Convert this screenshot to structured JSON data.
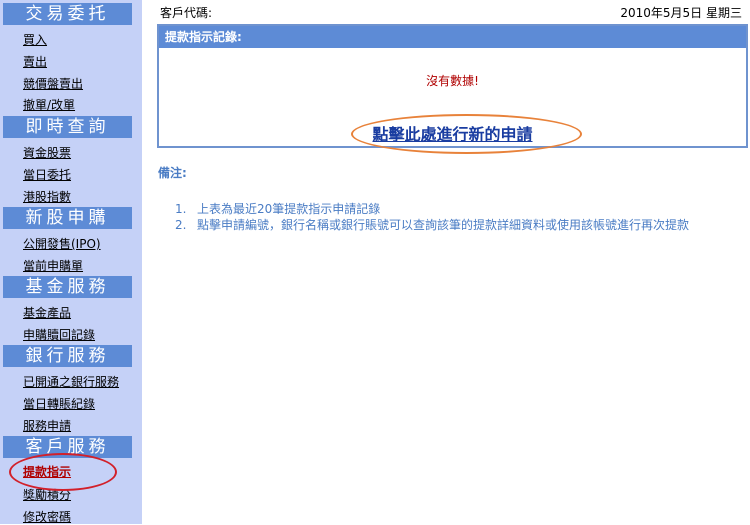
{
  "sidebar": {
    "sections": [
      {
        "title": "交易委托",
        "items": [
          "買入",
          "賣出",
          "競價盤賣出",
          "撤單/改單"
        ]
      },
      {
        "title": "即時查詢",
        "items": [
          "資金股票",
          "當日委托",
          "港股指數"
        ]
      },
      {
        "title": "新股申購",
        "items": [
          "公開發售(IPO)",
          "當前申購單"
        ]
      },
      {
        "title": "基金服務",
        "items": [
          "基金產品",
          "申購贖回記錄"
        ]
      },
      {
        "title": "銀行服務",
        "items": [
          "已開通之銀行服務",
          "當日轉賬紀錄",
          "服務申請"
        ]
      },
      {
        "title": "客戶服務",
        "items": [
          "提款指示",
          "獎勵積分",
          "修改密碼"
        ]
      }
    ]
  },
  "header": {
    "client_code_label": "客戶代碼:",
    "date": "2010年5月5日 星期三"
  },
  "panel": {
    "title": "提款指示記錄:",
    "no_data": "沒有數據!",
    "apply_link": "點擊此處進行新的申請"
  },
  "notes": {
    "title": "備注:",
    "items": [
      {
        "num": "1.",
        "text": "上表為最近20筆提款指示申請記錄"
      },
      {
        "num": "2.",
        "text": "點擊申請編號，銀行名稱或銀行賬號可以查詢該筆的提款詳細資料或使用該帳號進行再次提款"
      }
    ]
  },
  "colors": {
    "sidebar_bg": "#c5d1f7",
    "section_header_bg": "#5d8bd6",
    "accent_blue": "#4a7cc4",
    "error_red": "#b00000",
    "highlight_red_circle": "#d2202a",
    "highlight_orange_circle": "#e8823a"
  },
  "icons": [
    "highlight-circle-red",
    "highlight-circle-orange"
  ]
}
